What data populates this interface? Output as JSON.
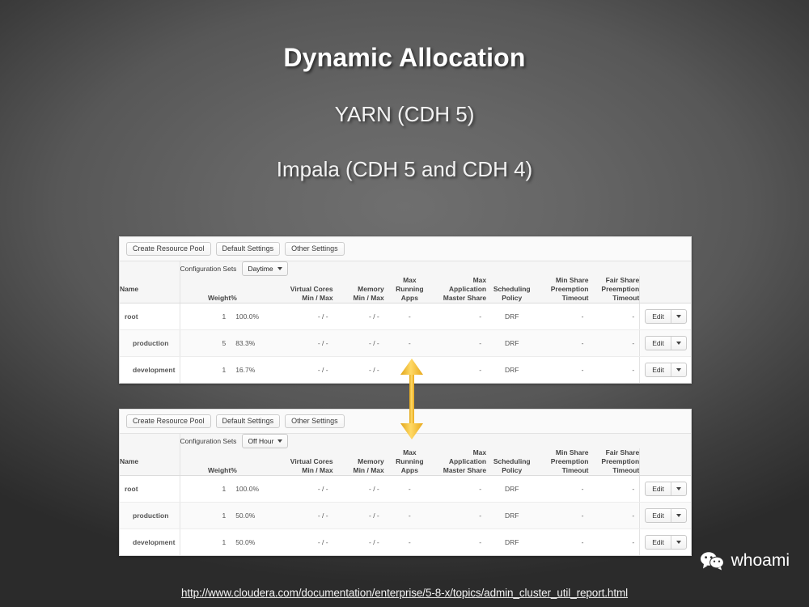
{
  "slide": {
    "title": "Dynamic Allocation",
    "sub_lines": [
      "YARN (CDH 5)",
      "Impala (CDH 5 and CDH 4)"
    ],
    "background_center": "#6f6f6f",
    "background_edge": "#2b2b2b"
  },
  "arrow": {
    "name": "double-headed-vertical-arrow",
    "color": "#f0b323",
    "highlight": "#ffd966"
  },
  "footer": {
    "url": "http://www.cloudera.com/documentation/enterprise/5-8-x/topics/admin_cluster_util_report.html",
    "brand_text": "whoami",
    "brand_icon": "wechat-icon"
  },
  "toolbar": {
    "create_pool_label": "Create Resource Pool",
    "default_settings_label": "Default Settings",
    "other_settings_label": "Other Settings"
  },
  "table": {
    "config_sets_label": "Configuration Sets",
    "name_header": "Name",
    "columns": [
      {
        "key": "weight",
        "lines": [
          "Weight"
        ]
      },
      {
        "key": "pct",
        "lines": [
          "%"
        ]
      },
      {
        "key": "vcores",
        "lines": [
          "Virtual Cores",
          "Min / Max"
        ]
      },
      {
        "key": "memory",
        "lines": [
          "Memory",
          "Min / Max"
        ]
      },
      {
        "key": "maxapps",
        "lines": [
          "Max",
          "Running",
          "Apps"
        ]
      },
      {
        "key": "ams",
        "lines": [
          "Max Application",
          "Master Share"
        ]
      },
      {
        "key": "sched",
        "lines": [
          "Scheduling",
          "Policy"
        ]
      },
      {
        "key": "minshare",
        "lines": [
          "Min Share",
          "Preemption",
          "Timeout"
        ]
      },
      {
        "key": "fairshare",
        "lines": [
          "Fair Share",
          "Preemption",
          "Timeout"
        ]
      }
    ],
    "edit_label": "Edit"
  },
  "panels": [
    {
      "id": "daytime-panel",
      "config_set_value": "Daytime",
      "rows": [
        {
          "name": "root",
          "indent": false,
          "weight": "1",
          "pct": "100.0%",
          "vcores": "- / -",
          "memory": "- / -",
          "maxapps": "-",
          "ams": "-",
          "sched": "DRF",
          "minshare": "-",
          "fairshare": "-"
        },
        {
          "name": "production",
          "indent": true,
          "weight": "5",
          "pct": "83.3%",
          "vcores": "- / -",
          "memory": "- / -",
          "maxapps": "-",
          "ams": "-",
          "sched": "DRF",
          "minshare": "-",
          "fairshare": "-"
        },
        {
          "name": "development",
          "indent": true,
          "weight": "1",
          "pct": "16.7%",
          "vcores": "- / -",
          "memory": "- / -",
          "maxapps": "-",
          "ams": "-",
          "sched": "DRF",
          "minshare": "-",
          "fairshare": "-"
        }
      ]
    },
    {
      "id": "offhour-panel",
      "config_set_value": "Off Hour",
      "rows": [
        {
          "name": "root",
          "indent": false,
          "weight": "1",
          "pct": "100.0%",
          "vcores": "- / -",
          "memory": "- / -",
          "maxapps": "-",
          "ams": "-",
          "sched": "DRF",
          "minshare": "-",
          "fairshare": "-"
        },
        {
          "name": "production",
          "indent": true,
          "weight": "1",
          "pct": "50.0%",
          "vcores": "- / -",
          "memory": "- / -",
          "maxapps": "-",
          "ams": "-",
          "sched": "DRF",
          "minshare": "-",
          "fairshare": "-"
        },
        {
          "name": "development",
          "indent": true,
          "weight": "1",
          "pct": "50.0%",
          "vcores": "- / -",
          "memory": "- / -",
          "maxapps": "-",
          "ams": "-",
          "sched": "DRF",
          "minshare": "-",
          "fairshare": "-"
        }
      ]
    }
  ]
}
